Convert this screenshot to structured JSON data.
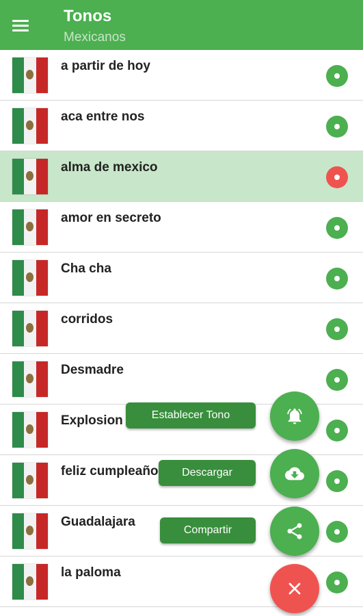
{
  "appbar": {
    "title": "Tonos",
    "subtitle": "Mexicanos",
    "menu_icon": "menu-icon",
    "color": "#4caf50"
  },
  "tones": [
    {
      "label": "a partir de hoy",
      "selected": false
    },
    {
      "label": "aca entre nos",
      "selected": false
    },
    {
      "label": "alma de mexico",
      "selected": true
    },
    {
      "label": "amor en secreto",
      "selected": false
    },
    {
      "label": "Cha cha",
      "selected": false
    },
    {
      "label": "corridos",
      "selected": false
    },
    {
      "label": "Desmadre",
      "selected": false
    },
    {
      "label": "Explosion",
      "selected": false
    },
    {
      "label": "feliz cumpleaños",
      "selected": false
    },
    {
      "label": "Guadalajara",
      "selected": false
    },
    {
      "label": "la paloma",
      "selected": false
    }
  ],
  "fab_menu": {
    "set_tone_label": "Establecer Tono",
    "download_label": "Descargar",
    "share_label": "Compartir",
    "set_tone_icon": "bell-icon",
    "download_icon": "cloud-download-icon",
    "share_icon": "share-icon",
    "close_icon": "close-icon"
  },
  "colors": {
    "accent": "#4caf50",
    "selected_row": "#c8e6c9",
    "playing_dot": "#ef5350",
    "label_bg": "#388e3c"
  }
}
